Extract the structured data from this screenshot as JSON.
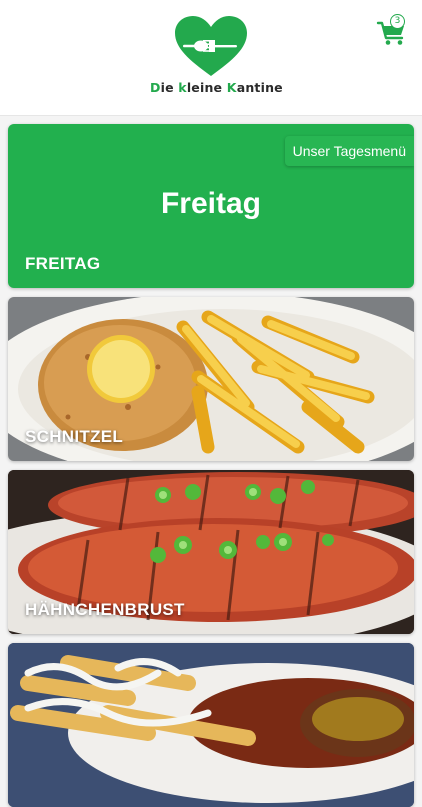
{
  "header": {
    "logo_text_parts": [
      "D",
      "ie ",
      "k",
      "leine ",
      "K",
      "antine"
    ],
    "cart_count": "3"
  },
  "menu": {
    "today": {
      "title": "Freitag",
      "tag": "Unser Tagesmenü",
      "label": "FREITAG"
    },
    "items": [
      {
        "label": "SCHNITZEL"
      },
      {
        "label": "HÄHNCHENBRUST"
      },
      {
        "label": ""
      }
    ]
  },
  "colors": {
    "brand_green": "#23a94d",
    "card_green": "#22b04e"
  }
}
